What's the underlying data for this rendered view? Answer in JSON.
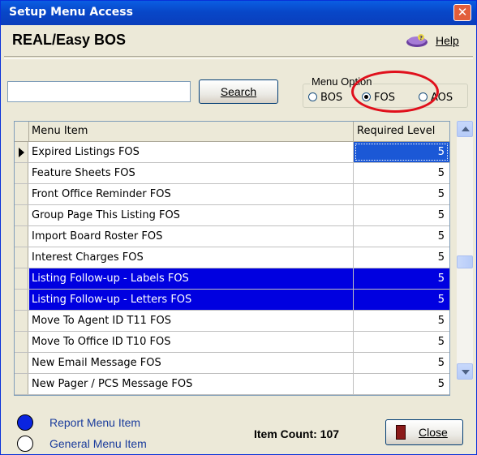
{
  "window": {
    "title": "Setup Menu Access",
    "close_glyph": "✕"
  },
  "header": {
    "app_title": "REAL/Easy BOS",
    "help_label": "Help"
  },
  "search": {
    "value": "",
    "button_label": "Search"
  },
  "menu_option": {
    "legend": "Menu Option",
    "options": [
      {
        "label": "BOS",
        "selected": false
      },
      {
        "label": "FOS",
        "selected": true
      },
      {
        "label": "AOS",
        "selected": false
      }
    ]
  },
  "grid": {
    "columns": [
      "Menu Item",
      "Required Level"
    ],
    "rows": [
      {
        "name": "Expired Listings FOS",
        "level": "5",
        "current": true
      },
      {
        "name": "Feature Sheets FOS",
        "level": "5"
      },
      {
        "name": "Front Office Reminder FOS",
        "level": "5"
      },
      {
        "name": "Group Page This Listing FOS",
        "level": "5"
      },
      {
        "name": "Import Board Roster FOS",
        "level": "5"
      },
      {
        "name": "Interest Charges FOS",
        "level": "5"
      },
      {
        "name": "Listing Follow-up - Labels FOS",
        "level": "5",
        "selected": true
      },
      {
        "name": "Listing Follow-up - Letters FOS",
        "level": "5",
        "selected": true
      },
      {
        "name": "Move To Agent ID  T11 FOS",
        "level": "5"
      },
      {
        "name": "Move To Office ID  T10 FOS",
        "level": "5"
      },
      {
        "name": "New Email Message FOS",
        "level": "5"
      },
      {
        "name": "New Pager / PCS Message FOS",
        "level": "5"
      }
    ]
  },
  "legend": {
    "report_label": "Report Menu Item",
    "report_color": "#0a24e0",
    "general_label": "General Menu Item",
    "general_color": "#ffffff"
  },
  "footer": {
    "item_count": "Item Count: 107",
    "close_label": "Close"
  },
  "colors": {
    "accent": "#0a5ee3",
    "selection": "#0000e0",
    "highlight_circle": "#e0101c"
  }
}
